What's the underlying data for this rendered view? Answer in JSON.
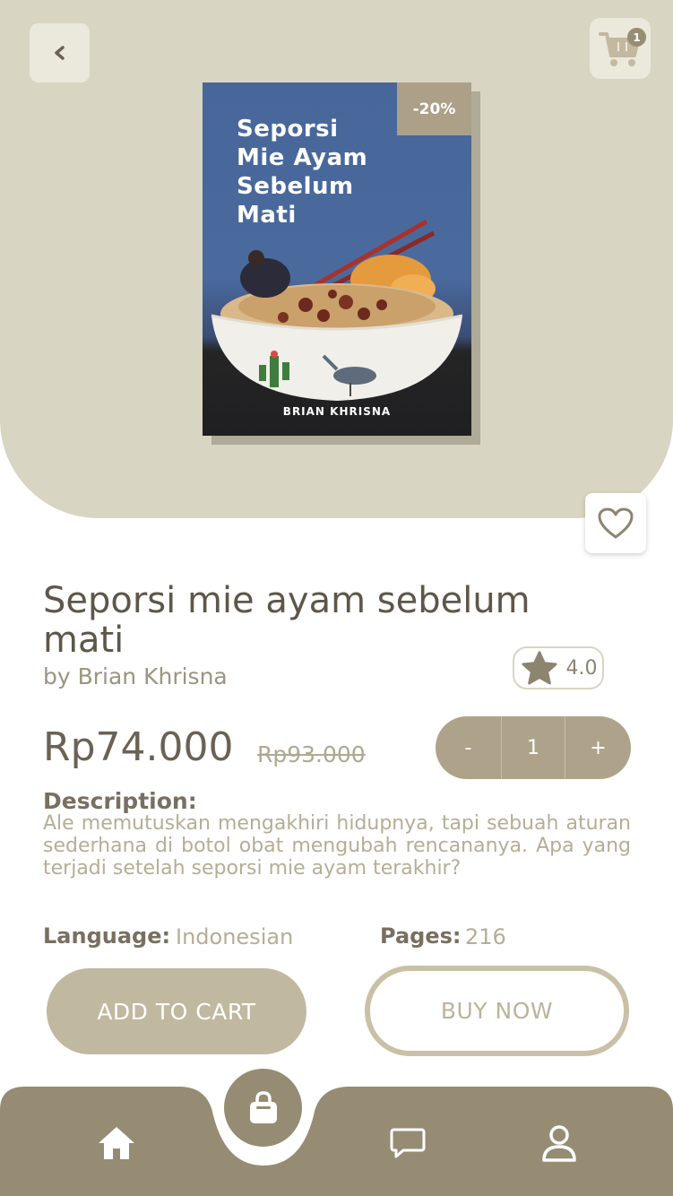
{
  "header": {
    "back_icon": "chevron-left-icon",
    "cart_icon": "cart-icon",
    "cart_count": "1"
  },
  "book": {
    "cover_title": "Seporsi\nMie Ayam\nSebelum\nMati",
    "cover_author": "BRIAN KHRISNA",
    "discount": "-20%",
    "title": "Seporsi mie ayam sebelum mati",
    "author": "by Brian Khrisna",
    "rating": "4.0",
    "price": "Rp74.000",
    "old_price": "Rp93.000",
    "description_label": "Description:",
    "description": "Ale memutuskan mengakhiri hidupnya, tapi sebuah aturan sederhana di botol obat mengubah rencananya. Apa yang terjadi setelah seporsi mie ayam terakhir?",
    "language_label": "Language:",
    "language": "Indonesian",
    "pages_label": "Pages:",
    "pages": "216"
  },
  "quantity": {
    "minus": "-",
    "value": "1",
    "plus": "+"
  },
  "actions": {
    "add_to_cart": "ADD TO CART",
    "buy_now": "BUY NOW"
  },
  "nav": {
    "items": [
      "home-icon",
      "bag-icon",
      "chat-icon",
      "profile-icon"
    ]
  },
  "colors": {
    "hero_bg": "#d8d5c2",
    "accent": "#aea38a",
    "nav_bg": "#968c74",
    "text_dark": "#5e5649",
    "text_muted": "#b6ad96"
  }
}
